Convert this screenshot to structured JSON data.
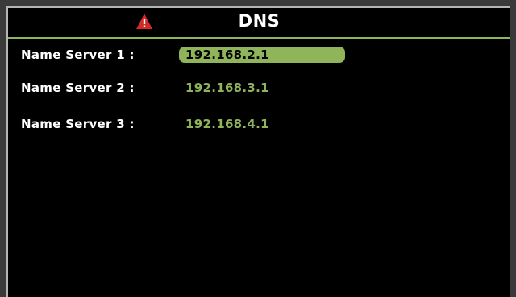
{
  "header": {
    "title": "DNS",
    "warning_icon": "warning-triangle-icon"
  },
  "colors": {
    "accent": "#8fb45a",
    "background": "#000000",
    "warning": "#d12a2a"
  },
  "fields": [
    {
      "label": "Name Server 1 :",
      "value": "192.168.2.1",
      "selected": true
    },
    {
      "label": "Name Server 2 :",
      "value": "192.168.3.1",
      "selected": false
    },
    {
      "label": "Name Server 3 :",
      "value": "192.168.4.1",
      "selected": false
    }
  ]
}
